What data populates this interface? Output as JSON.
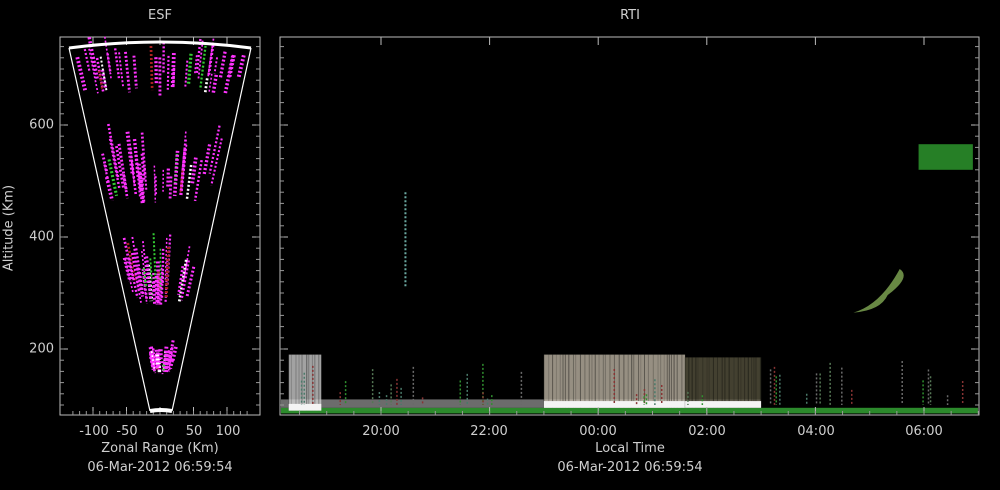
{
  "esf": {
    "title": "ESF",
    "ylabel": "Altitude (Km)",
    "xlabel": "Zonal Range (Km)",
    "timestamp": "06-Mar-2012 06:59:54",
    "xticks": [
      "-100",
      "-50",
      "0",
      "50",
      "100"
    ],
    "yticks": [
      "200",
      "400",
      "600"
    ]
  },
  "rti": {
    "title": "RTI",
    "xlabel": "Local Time",
    "timestamp": "06-Mar-2012 06:59:54",
    "xticks": [
      "20:00",
      "22:00",
      "00:00",
      "02:00",
      "04:00",
      "06:00"
    ]
  },
  "chart_data": [
    {
      "type": "heatmap",
      "title": "ESF",
      "xlabel": "Zonal Range (Km)",
      "ylabel": "Altitude (Km)",
      "xlim": [
        -140,
        140
      ],
      "ylim": [
        85,
        750
      ],
      "x_ticks": [
        -100,
        -50,
        0,
        50,
        100
      ],
      "y_ticks": [
        200,
        400,
        600
      ],
      "colors": {
        "echo": "#ff33ff",
        "strong": "#ffffff",
        "weak": "#33cc33",
        "noise": "#aa2222"
      },
      "echo_layers_altitude_km": [
        [
          155,
          200
        ],
        [
          275,
          380
        ],
        [
          460,
          570
        ],
        [
          650,
          740
        ]
      ]
    },
    {
      "type": "heatmap",
      "title": "RTI",
      "xlabel": "Local Time",
      "ylim": [
        85,
        750
      ],
      "x_range_hours": [
        18.2,
        31.0
      ],
      "x_tick_hours": [
        20,
        22,
        24,
        26,
        28,
        30
      ],
      "x_tick_labels": [
        "20:00",
        "22:00",
        "00:00",
        "02:00",
        "04:00",
        "06:00"
      ],
      "features": [
        {
          "kind": "bottomside_band",
          "t_start": 18.3,
          "t_end": 18.9,
          "alt_lo": 90,
          "alt_hi": 190,
          "color": "#d8d8d8"
        },
        {
          "kind": "bottomside_band",
          "t_start": 23.0,
          "t_end": 25.6,
          "alt_lo": 95,
          "alt_hi": 190,
          "color": "#c8bfae"
        },
        {
          "kind": "bottomside_band",
          "t_start": 25.6,
          "t_end": 27.0,
          "alt_lo": 95,
          "alt_hi": 185,
          "color": "#5a5540"
        },
        {
          "kind": "plume",
          "t": 20.45,
          "alt_lo": 310,
          "alt_hi": 480,
          "color": "#6aa8a0"
        },
        {
          "kind": "patch",
          "t_start": 28.7,
          "t_end": 29.7,
          "alt_lo": 265,
          "alt_hi": 350,
          "color": "#7aa050"
        },
        {
          "kind": "patch",
          "t_start": 29.9,
          "t_end": 30.9,
          "alt_lo": 520,
          "alt_hi": 580,
          "color": "#33aa33"
        }
      ]
    }
  ]
}
